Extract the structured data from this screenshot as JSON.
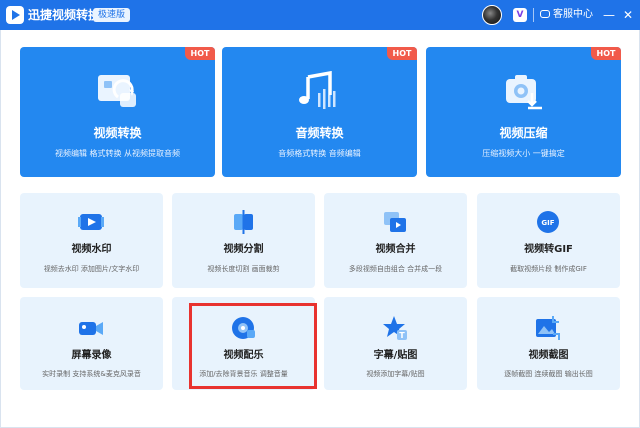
{
  "window": {
    "title": "迅捷视频转换器",
    "edition_badge": "极速版",
    "service_label": "客服中心",
    "vip_label": "V",
    "minimize": "—",
    "close": "✕"
  },
  "featured": [
    {
      "title": "视频转换",
      "desc": "视频编辑 格式转换 从视频提取音频",
      "hot": "HOT",
      "icon": "video-convert-icon"
    },
    {
      "title": "音频转换",
      "desc": "音频格式转换 音频编辑",
      "hot": "HOT",
      "icon": "music-note-icon"
    },
    {
      "title": "视频压缩",
      "desc": "压缩视频大小 一键搞定",
      "hot": "HOT",
      "icon": "compress-camera-icon"
    }
  ],
  "tools": [
    {
      "title": "视频水印",
      "desc": "视频去水印 添加图片/文字水印",
      "icon": "watermark-icon"
    },
    {
      "title": "视频分割",
      "desc": "视频长度切割 画面裁剪",
      "icon": "split-icon"
    },
    {
      "title": "视频合并",
      "desc": "多段视频自由组合 合并成一段",
      "icon": "merge-icon"
    },
    {
      "title": "视频转GIF",
      "desc": "截取视频片段 制作成GIF",
      "icon": "gif-icon"
    },
    {
      "title": "屏幕录像",
      "desc": "实时录制 支持系统&麦克风录音",
      "icon": "camera-record-icon"
    },
    {
      "title": "视频配乐",
      "desc": "添加/去除背景音乐 调整音量",
      "icon": "music-disc-icon"
    },
    {
      "title": "字幕/贴图",
      "desc": "视频添加字幕/贴图",
      "icon": "star-sticker-icon"
    },
    {
      "title": "视频截图",
      "desc": "逐帧截图 连续截图 输出长图",
      "icon": "screenshot-icon"
    }
  ],
  "colors": {
    "titlebar": "#1f73e8",
    "featured_card": "#2388f0",
    "tool_card": "#e8f3fd",
    "hot_badge": "#f15a4a",
    "highlight_box": "#e8322f"
  }
}
